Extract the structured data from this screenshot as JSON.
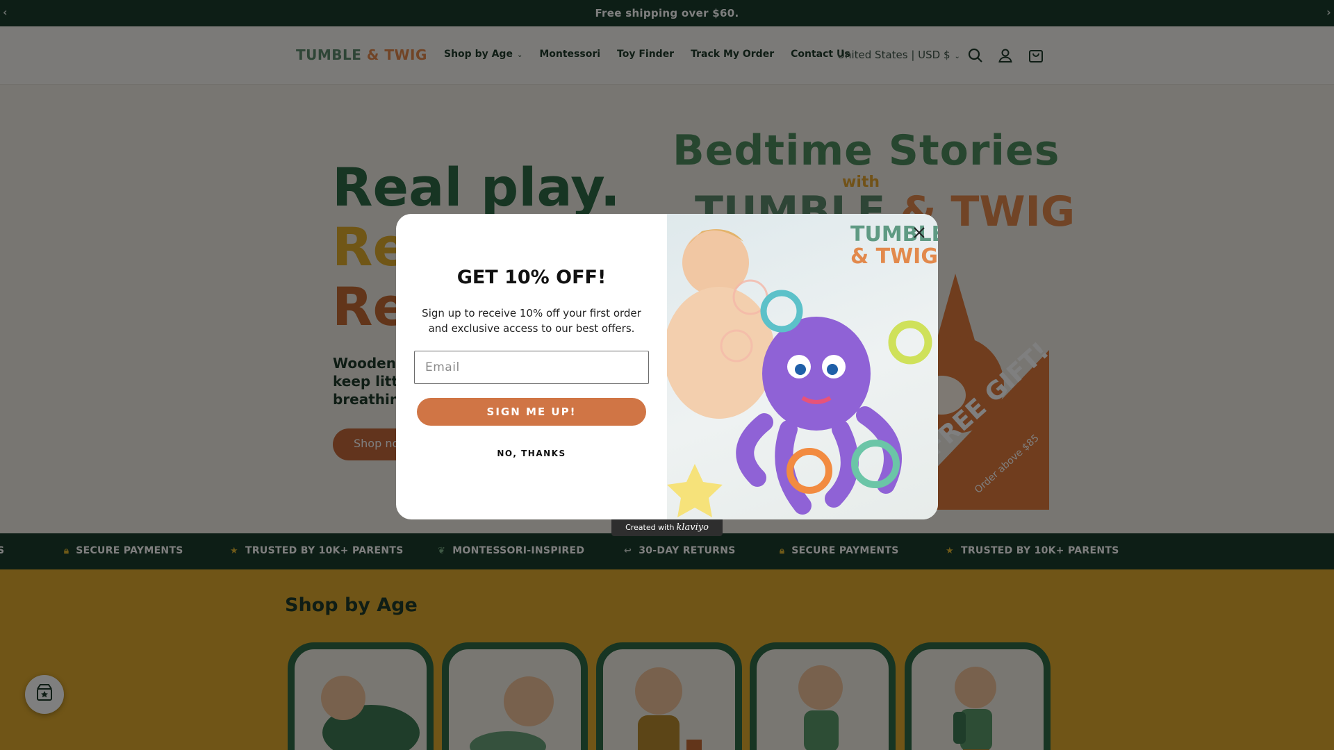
{
  "announcement": {
    "text": "Free shipping over $60."
  },
  "header": {
    "logo": {
      "part1": "TUMBLE",
      "amp": " & ",
      "part2": "TWIG"
    },
    "nav": [
      {
        "label": "Shop by Age",
        "has_dropdown": true
      },
      {
        "label": "Montessori"
      },
      {
        "label": "Toy Finder"
      },
      {
        "label": "Track My Order"
      },
      {
        "label": "Contact Us"
      }
    ],
    "locale": "United States | USD $"
  },
  "hero": {
    "headline_1": "Real play.",
    "headline_2": "Re",
    "headline_3": "Re",
    "subtext": [
      "Wooden",
      "keep littl",
      "breathin"
    ],
    "cta_label": "Shop no",
    "promo": {
      "title": "Bedtime Stories",
      "with": "with",
      "brand_1": "TUMBLE",
      "brand_amp": "&",
      "brand_2": "TWIG",
      "gift": "FREE GIFT!",
      "gift_note": "Order above $85"
    }
  },
  "modal": {
    "title": "GET 10% OFF!",
    "description": "Sign up to receive 10% off your first order and exclusive access to our best offers.",
    "email_placeholder": "Email",
    "submit_label": "SIGN ME UP!",
    "decline_label": "NO, THANKS",
    "logo_line1": "TUMBLE",
    "logo_amp": "&",
    "logo_line2": "TWIG",
    "powered_by": "Created with",
    "powered_brand": "klaviyo"
  },
  "trust_bar": [
    {
      "text": "S",
      "icon": "star-icon"
    },
    {
      "text": "SECURE PAYMENTS",
      "icon": "lock-icon"
    },
    {
      "text": "TRUSTED BY 10K+ PARENTS",
      "icon": "star-icon"
    },
    {
      "text": "MONTESSORI-INSPIRED",
      "icon": "leaf-icon"
    },
    {
      "text": "30-DAY RETURNS",
      "icon": "return-icon"
    },
    {
      "text": "SECURE PAYMENTS",
      "icon": "lock-icon"
    },
    {
      "text": "TRUSTED BY 10K+ PARENTS",
      "icon": "star-icon"
    }
  ],
  "shop_by_age": {
    "title": "Shop by Age"
  },
  "colors": {
    "brand_green": "#1b3d2c",
    "accent_orange": "#d07545",
    "accent_yellow": "#e0aa2e"
  }
}
